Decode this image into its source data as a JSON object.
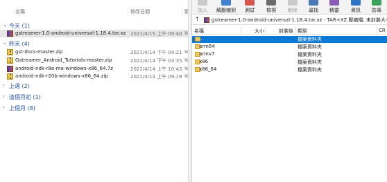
{
  "explorer": {
    "columns": {
      "name": "名稱",
      "date": "修改日期",
      "type": "類"
    },
    "groups": [
      {
        "label": "今天 (1)",
        "expanded": true
      },
      {
        "label": "昨天 (4)",
        "expanded": true
      },
      {
        "label": "上週 (2)",
        "expanded": false
      },
      {
        "label": "這個月初 (1)",
        "expanded": false
      },
      {
        "label": "上個月 (8)",
        "expanded": false
      }
    ],
    "today_files": [
      {
        "name": "gstreamer-1.0-android-universal-1.18.4.tar.xz",
        "date": "2021/4/15 上午 09:40",
        "type": "W",
        "icon": "rar-icon",
        "selected": true
      }
    ],
    "yesterday_files": [
      {
        "name": "gst-docs-master.zip",
        "date": "2021/4/14 下午 04:21",
        "type": "W",
        "icon": "zip-icon"
      },
      {
        "name": "Gstreamer_Android_Tutorials-master.zip",
        "date": "2021/4/14 下午 03:35",
        "type": "W",
        "icon": "zip-icon"
      },
      {
        "name": "android-ndk-r8e-ma-windows-x86_64.7z",
        "date": "2021/4/14 上午 10:43",
        "type": "W",
        "icon": "rar-icon"
      },
      {
        "name": "android-ndk-r20b-windows-x86_64.zip",
        "date": "2021/4/14 上午 09:19",
        "type": "W",
        "icon": "zip-icon"
      }
    ]
  },
  "toolbar": {
    "buttons": [
      {
        "label": "加入",
        "icon": "add-icon",
        "color": "#c9c9c9",
        "disabled": true
      },
      {
        "label": "解壓縮到",
        "icon": "extract-to-icon",
        "color": "#3f7fd0",
        "disabled": false
      },
      {
        "label": "測試",
        "icon": "test-icon",
        "color": "#d9534f",
        "disabled": false
      },
      {
        "label": "檢視",
        "icon": "view-icon",
        "color": "#6b6b6b",
        "disabled": false
      },
      {
        "label": "刪除",
        "icon": "delete-icon",
        "color": "#c9c9c9",
        "disabled": true
      },
      {
        "label": "尋找",
        "icon": "find-icon",
        "color": "#4a7ab8",
        "disabled": false
      },
      {
        "label": "精靈",
        "icon": "wizard-icon",
        "color": "#8a5bb8",
        "disabled": false
      },
      {
        "label": "資訊",
        "icon": "info-icon",
        "color": "#2d74c7",
        "disabled": false
      },
      {
        "label": "防毒",
        "icon": "virus-scan-icon",
        "color": "#3aa35b",
        "disabled": false
      }
    ]
  },
  "addressbar": {
    "path": "gstreamer-1.0-android-universal-1.18.4.tar.xz - TAR+XZ 壓縮檔, 未封裝大小 2,03"
  },
  "archive": {
    "columns": {
      "name": "名稱",
      "size": "大小",
      "packed": "封裝後",
      "type": "類型",
      "crc": "CR"
    },
    "rows": [
      {
        "name": "..",
        "type": "檔案資料夾",
        "selected": true
      },
      {
        "name": "arm64",
        "type": "檔案資料夾"
      },
      {
        "name": "armv7",
        "type": "檔案資料夾"
      },
      {
        "name": "x86",
        "type": "檔案資料夾"
      },
      {
        "name": "x86_64",
        "type": "檔案資料夾"
      }
    ]
  }
}
